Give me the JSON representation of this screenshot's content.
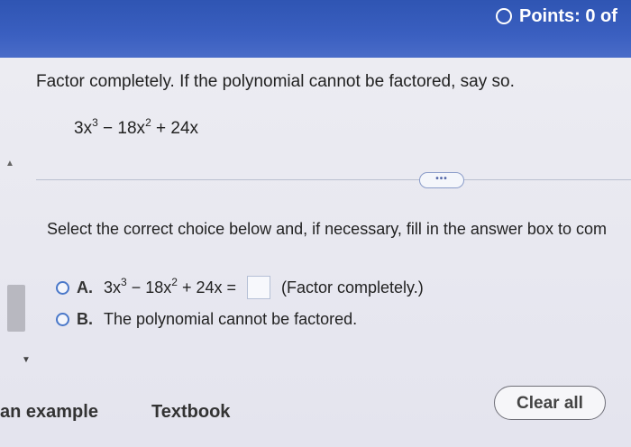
{
  "header": {
    "points_label": "Points: 0 of"
  },
  "question": {
    "prompt": "Factor completely. If the polynomial cannot be factored, say so.",
    "expression": {
      "t1": "3x",
      "e1": "3",
      "t2": " − 18x",
      "e2": "2",
      "t3": " + 24x"
    },
    "more_button_label": "•••",
    "instruction": "Select the correct choice below and, if necessary, fill in the answer box to com"
  },
  "choices": {
    "a": {
      "letter": "A.",
      "expr_t1": "3x",
      "expr_e1": "3",
      "expr_t2": " − 18x",
      "expr_e2": "2",
      "expr_t3": " + 24x =",
      "hint": "(Factor completely.)"
    },
    "b": {
      "letter": "B.",
      "text": "The polynomial cannot be factored."
    }
  },
  "footer": {
    "example_label": "an example",
    "textbook_label": "Textbook",
    "clear_all_label": "Clear all"
  }
}
